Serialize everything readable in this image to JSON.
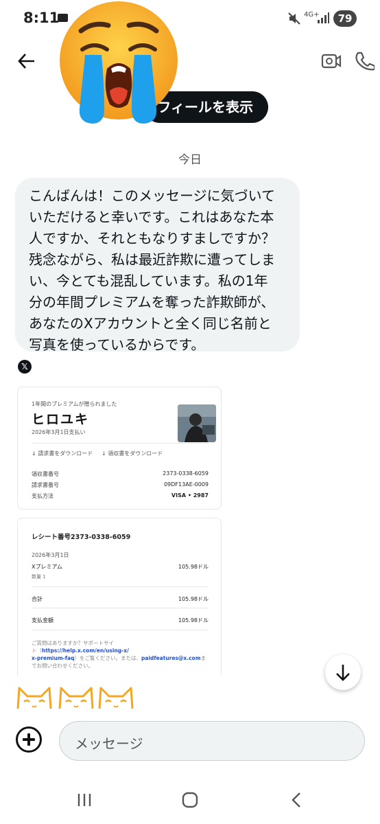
{
  "status_bar": {
    "time": "8:11",
    "network": "4G+",
    "battery": "79"
  },
  "header": {
    "profile_button": "フィールを表示"
  },
  "chat": {
    "day_label": "今日",
    "message_lines": [
      "こんばんは！このメッセージに気づいて",
      "いただけると幸いです。これはあなた本",
      "人ですか、それともなりすましですか？",
      "残念ながら、私は最近詐欺に遭ってしま",
      "い、今とても混乱しています。私の1年",
      "分の年間プレミアムを奪った詐欺師が、",
      "あなたのXアカウントと全く同じ名前と",
      "写真を使っているからです。"
    ],
    "x_logo": "𝕏"
  },
  "receipt_card": {
    "caption": "1年間のプレミアムが贈られました",
    "name": "ヒロユキ",
    "paid_date": "2026年3月1日支払い",
    "download_invoice": "↓ 請求書をダウンロード",
    "download_receipt": "↓ 領収書をダウンロード",
    "rows": [
      {
        "label": "領収書番号",
        "value": "2373-0338-6059"
      },
      {
        "label": "請求書番号",
        "value": "09DF13AE-0009"
      },
      {
        "label": "支払方法",
        "value": "VISA • 2987"
      }
    ]
  },
  "receipt_detail": {
    "title": "レシート番号2373-0338-6059",
    "date": "2026年3月1日",
    "item": "Xプレミアム",
    "item_price": "105.98ドル",
    "qty": "数量 1",
    "total_label": "合計",
    "total": "105.98ドル",
    "paid_label": "支払金額",
    "paid": "105.98ドル",
    "footer_1": "ご質問はありますか？サポートサイ",
    "footer_2a": "ト（",
    "footer_link1": "https://help.x.com/en/using-x/",
    "footer_link2": "x-premium-faq",
    "footer_2b": "）をご覧ください。または、",
    "footer_link3": "paidfeatures@x.com",
    "footer_2c": "ま",
    "footer_3": "でお問い合わせください。"
  },
  "composer": {
    "placeholder": "メッセージ"
  },
  "colors": {
    "bubble": "#eff3f4",
    "pill": "#0f1419",
    "cat": "#f5a623"
  }
}
